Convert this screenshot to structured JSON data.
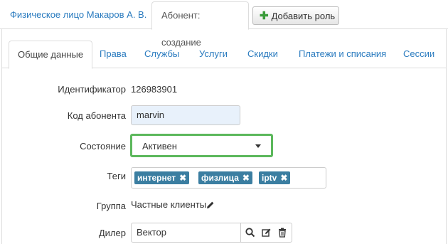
{
  "top_tabs": {
    "person_tab": "Физическое лицо Макаров А. В.",
    "subscriber_tab": "Абонент: создание",
    "add_role_label": "Добавить роль"
  },
  "sub_tabs": [
    "Общие данные",
    "Права",
    "Службы",
    "Услуги",
    "Скидки",
    "Платежи и списания",
    "Сессии"
  ],
  "active_sub_tab": "Общие данные",
  "form": {
    "identifier": {
      "label": "Идентификатор",
      "value": "126983901"
    },
    "code": {
      "label": "Код абонента",
      "value": "marvin"
    },
    "status": {
      "label": "Состояние",
      "value": "Активен"
    },
    "tags": {
      "label": "Теги",
      "items": [
        "интернет",
        "физлица",
        "iptv"
      ]
    },
    "group": {
      "label": "Группа",
      "value": "Частные клиенты"
    },
    "dealer": {
      "label": "Дилер",
      "value": "Вектор"
    }
  },
  "colors": {
    "link": "#2a7bbf",
    "tag_bg": "#3b7ea1",
    "select_focus_border": "#5cb85c",
    "input_autofill_bg": "#e8f1fb"
  },
  "icons": [
    "plus-icon",
    "caret-down-icon",
    "remove-tag-icon",
    "pencil-icon",
    "search-icon",
    "edit-icon",
    "trash-icon"
  ]
}
